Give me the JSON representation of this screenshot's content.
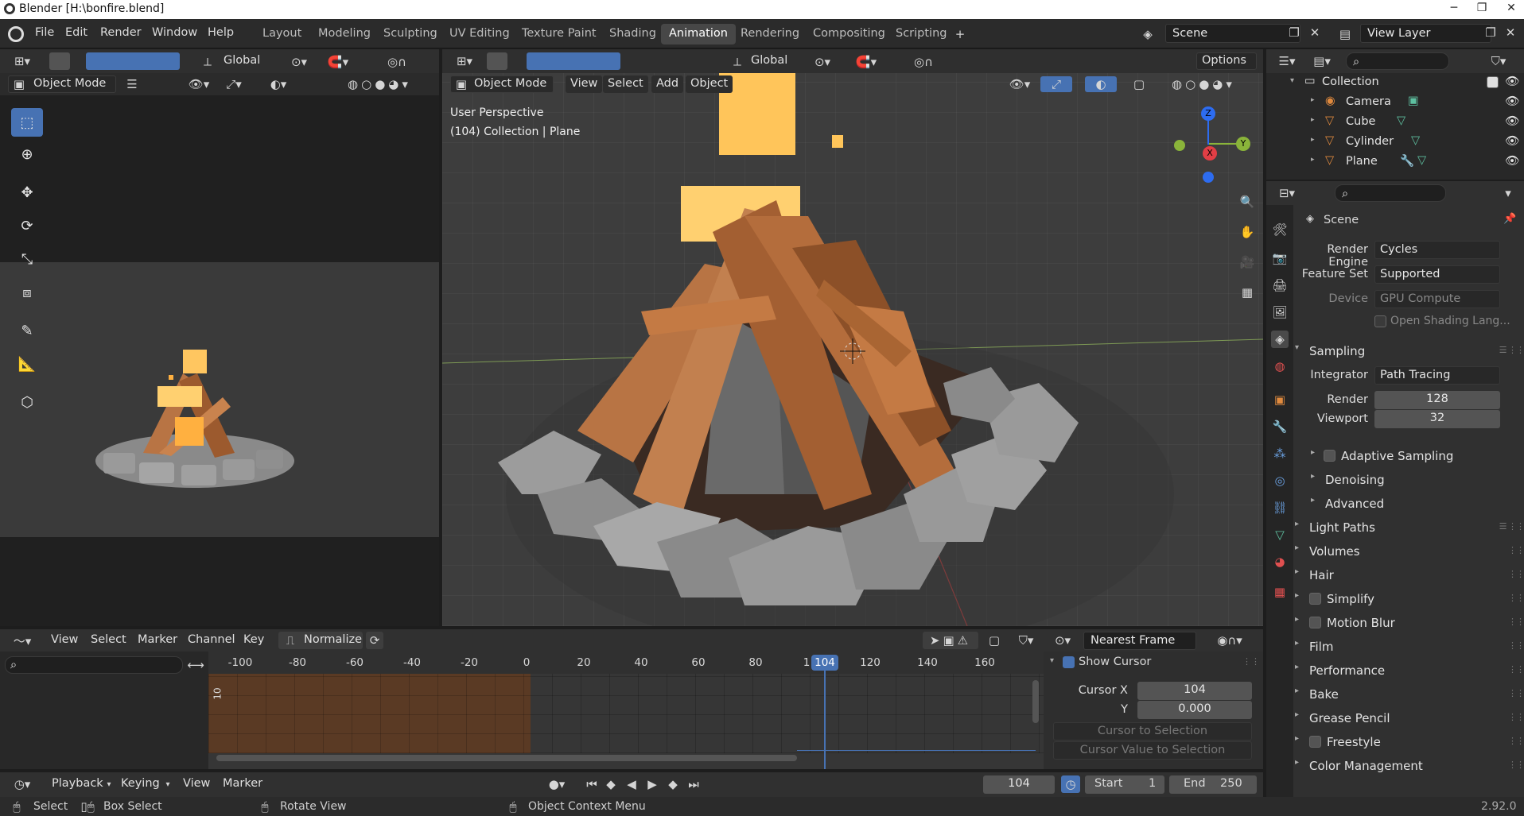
{
  "window": {
    "title": "Blender [H:\\bonfire.blend]",
    "minimize": "─",
    "maximize": "❐",
    "close": "✕"
  },
  "menus": [
    "File",
    "Edit",
    "Render",
    "Window",
    "Help"
  ],
  "workspaces": [
    "Layout",
    "Modeling",
    "Sculpting",
    "UV Editing",
    "Texture Paint",
    "Shading",
    "Animation",
    "Rendering",
    "Compositing",
    "Scripting"
  ],
  "active_workspace": "Animation",
  "scene": {
    "name": "Scene",
    "view_layer": "View Layer"
  },
  "left_view": {
    "orientation": "Global",
    "mode": "Object Mode"
  },
  "main_view": {
    "orientation": "Global",
    "mode": "Object Mode",
    "menus": [
      "View",
      "Select",
      "Add",
      "Object"
    ],
    "options": "Options",
    "info_line1": "User Perspective",
    "info_line2": "(104) Collection | Plane",
    "gizmo": {
      "z": "Z",
      "y": "Y",
      "x": "X"
    }
  },
  "outliner": {
    "collection": "Collection",
    "items": [
      {
        "name": "Camera",
        "icon": "camera-icon"
      },
      {
        "name": "Cube",
        "icon": "mesh-icon"
      },
      {
        "name": "Cylinder",
        "icon": "mesh-icon"
      },
      {
        "name": "Plane",
        "icon": "mesh-icon"
      }
    ]
  },
  "properties": {
    "context": "Scene",
    "render_engine_label": "Render Engine",
    "render_engine": "Cycles",
    "feature_set_label": "Feature Set",
    "feature_set": "Supported",
    "device_label": "Device",
    "device": "GPU Compute",
    "open_shading": "Open Shading Lang...",
    "sampling": "Sampling",
    "integrator_label": "Integrator",
    "integrator": "Path Tracing",
    "render_label": "Render",
    "render_samples": "128",
    "viewport_label": "Viewport",
    "viewport_samples": "32",
    "subsections": [
      "Adaptive Sampling",
      "Denoising",
      "Advanced"
    ],
    "sections": [
      "Light Paths",
      "Volumes",
      "Hair",
      "Simplify",
      "Motion Blur",
      "Film",
      "Performance",
      "Bake",
      "Grease Pencil",
      "Freestyle",
      "Color Management"
    ]
  },
  "graph_editor": {
    "menus": [
      "View",
      "Select",
      "Marker",
      "Channel",
      "Key"
    ],
    "normalize": "Normalize",
    "snap": "Nearest Frame",
    "ticks": [
      "-100",
      "-80",
      "-60",
      "-40",
      "-20",
      "0",
      "20",
      "40",
      "60",
      "80",
      "1",
      "120",
      "140",
      "160"
    ],
    "current_frame": "104",
    "y_label": "10",
    "show_cursor": "Show Cursor",
    "cursor_x_label": "Cursor X",
    "cursor_x": "104",
    "cursor_y_label": "Y",
    "cursor_y": "0.000",
    "cursor_to_selection": "Cursor to Selection",
    "cursor_value_to_selection": "Cursor Value to Selection"
  },
  "timeline": {
    "menus": [
      "Playback",
      "Keying",
      "View",
      "Marker"
    ],
    "frame": "104",
    "start_label": "Start",
    "start": "1",
    "end_label": "End",
    "end": "250"
  },
  "statusbar": {
    "select": "Select",
    "box_select": "Box Select",
    "rotate": "Rotate View",
    "context": "Object Context Menu",
    "version": "2.92.0"
  }
}
